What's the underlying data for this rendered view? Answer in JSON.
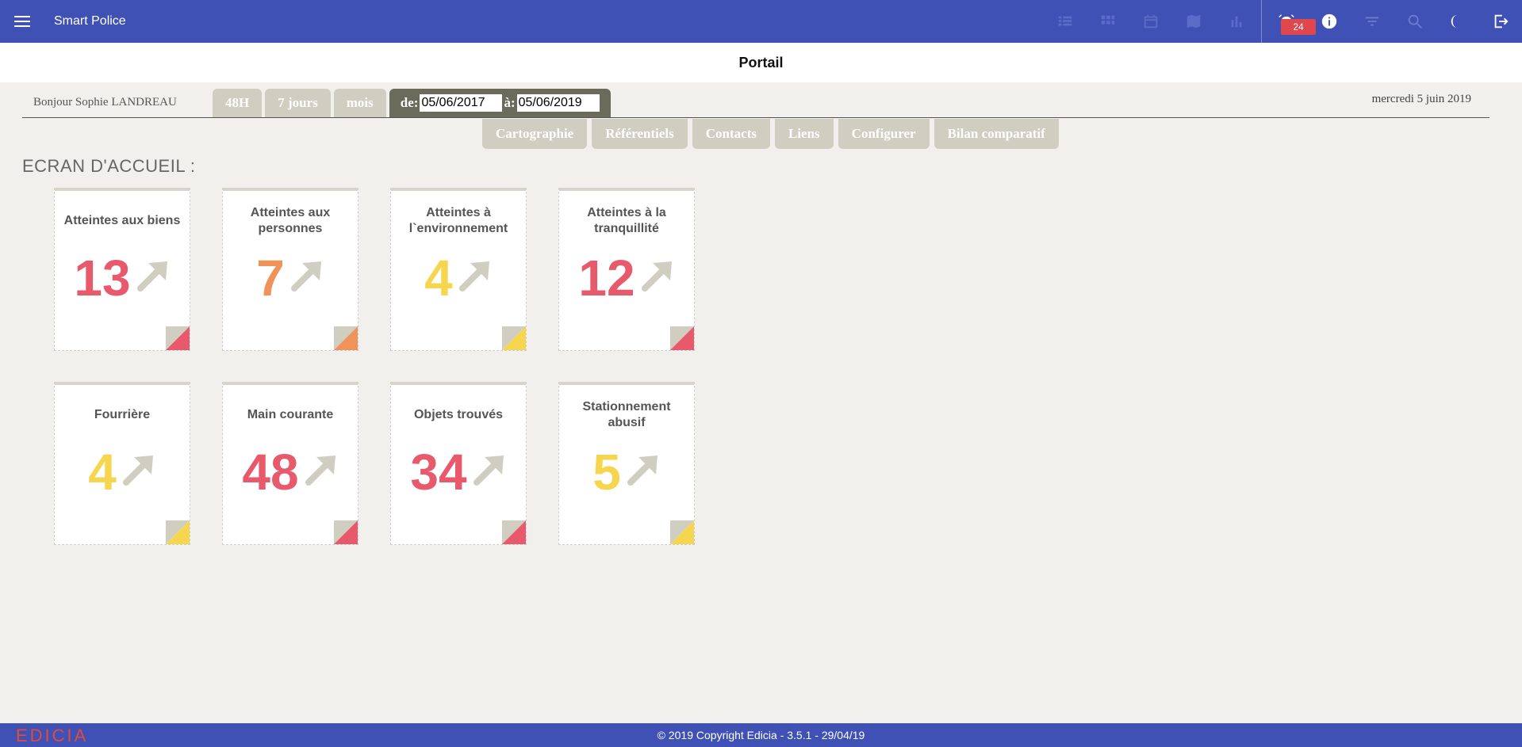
{
  "app": {
    "title": "Smart Police",
    "page_title": "Portail"
  },
  "toolbar": {
    "icons": [
      "list-icon",
      "grid-icon",
      "calendar-icon",
      "map-icon",
      "bar-chart-icon",
      "alarm-icon",
      "info-icon",
      "filter-icon",
      "search-icon",
      "night-mode-icon",
      "logout-icon"
    ],
    "alarm_badge": "24"
  },
  "header": {
    "greeting": "Bonjour Sophie LANDREAU",
    "today": "mercredi 5 juin 2019"
  },
  "period_tabs": [
    "48H",
    "7 jours",
    "mois"
  ],
  "range": {
    "from_label": "de:",
    "from": "05/06/2017",
    "to_label": "à:",
    "to": "05/06/2019"
  },
  "nav_tabs": [
    "Cartographie",
    "Référentiels",
    "Contacts",
    "Liens",
    "Configurer",
    "Bilan comparatif"
  ],
  "section_title": "ECRAN D'ACCUEIL :",
  "tiles": [
    {
      "label": "Atteintes aux biens",
      "value": "13",
      "color": "#e8596b"
    },
    {
      "label": "Atteintes aux personnes",
      "value": "7",
      "color": "#f0935a"
    },
    {
      "label": "Atteintes à l`environnement",
      "value": "4",
      "color": "#f7d64f"
    },
    {
      "label": "Atteintes à la tranquillité",
      "value": "12",
      "color": "#e8596b"
    },
    {
      "label": "Fourrière",
      "value": "4",
      "color": "#f7d64f"
    },
    {
      "label": "Main courante",
      "value": "48",
      "color": "#e8596b"
    },
    {
      "label": "Objets trouvés",
      "value": "34",
      "color": "#e8596b"
    },
    {
      "label": "Stationnement abusif",
      "value": "5",
      "color": "#f7d64f"
    }
  ],
  "footer": {
    "copyright": "© 2019 Copyright Edicia - 3.5.1 - 29/04/19",
    "brand": "EDICIA"
  },
  "colors": {
    "primary": "#3f51b5",
    "tab": "#d0cdc1",
    "tab_active": "#6b6b5c",
    "arrow": "#d0cdc1"
  }
}
